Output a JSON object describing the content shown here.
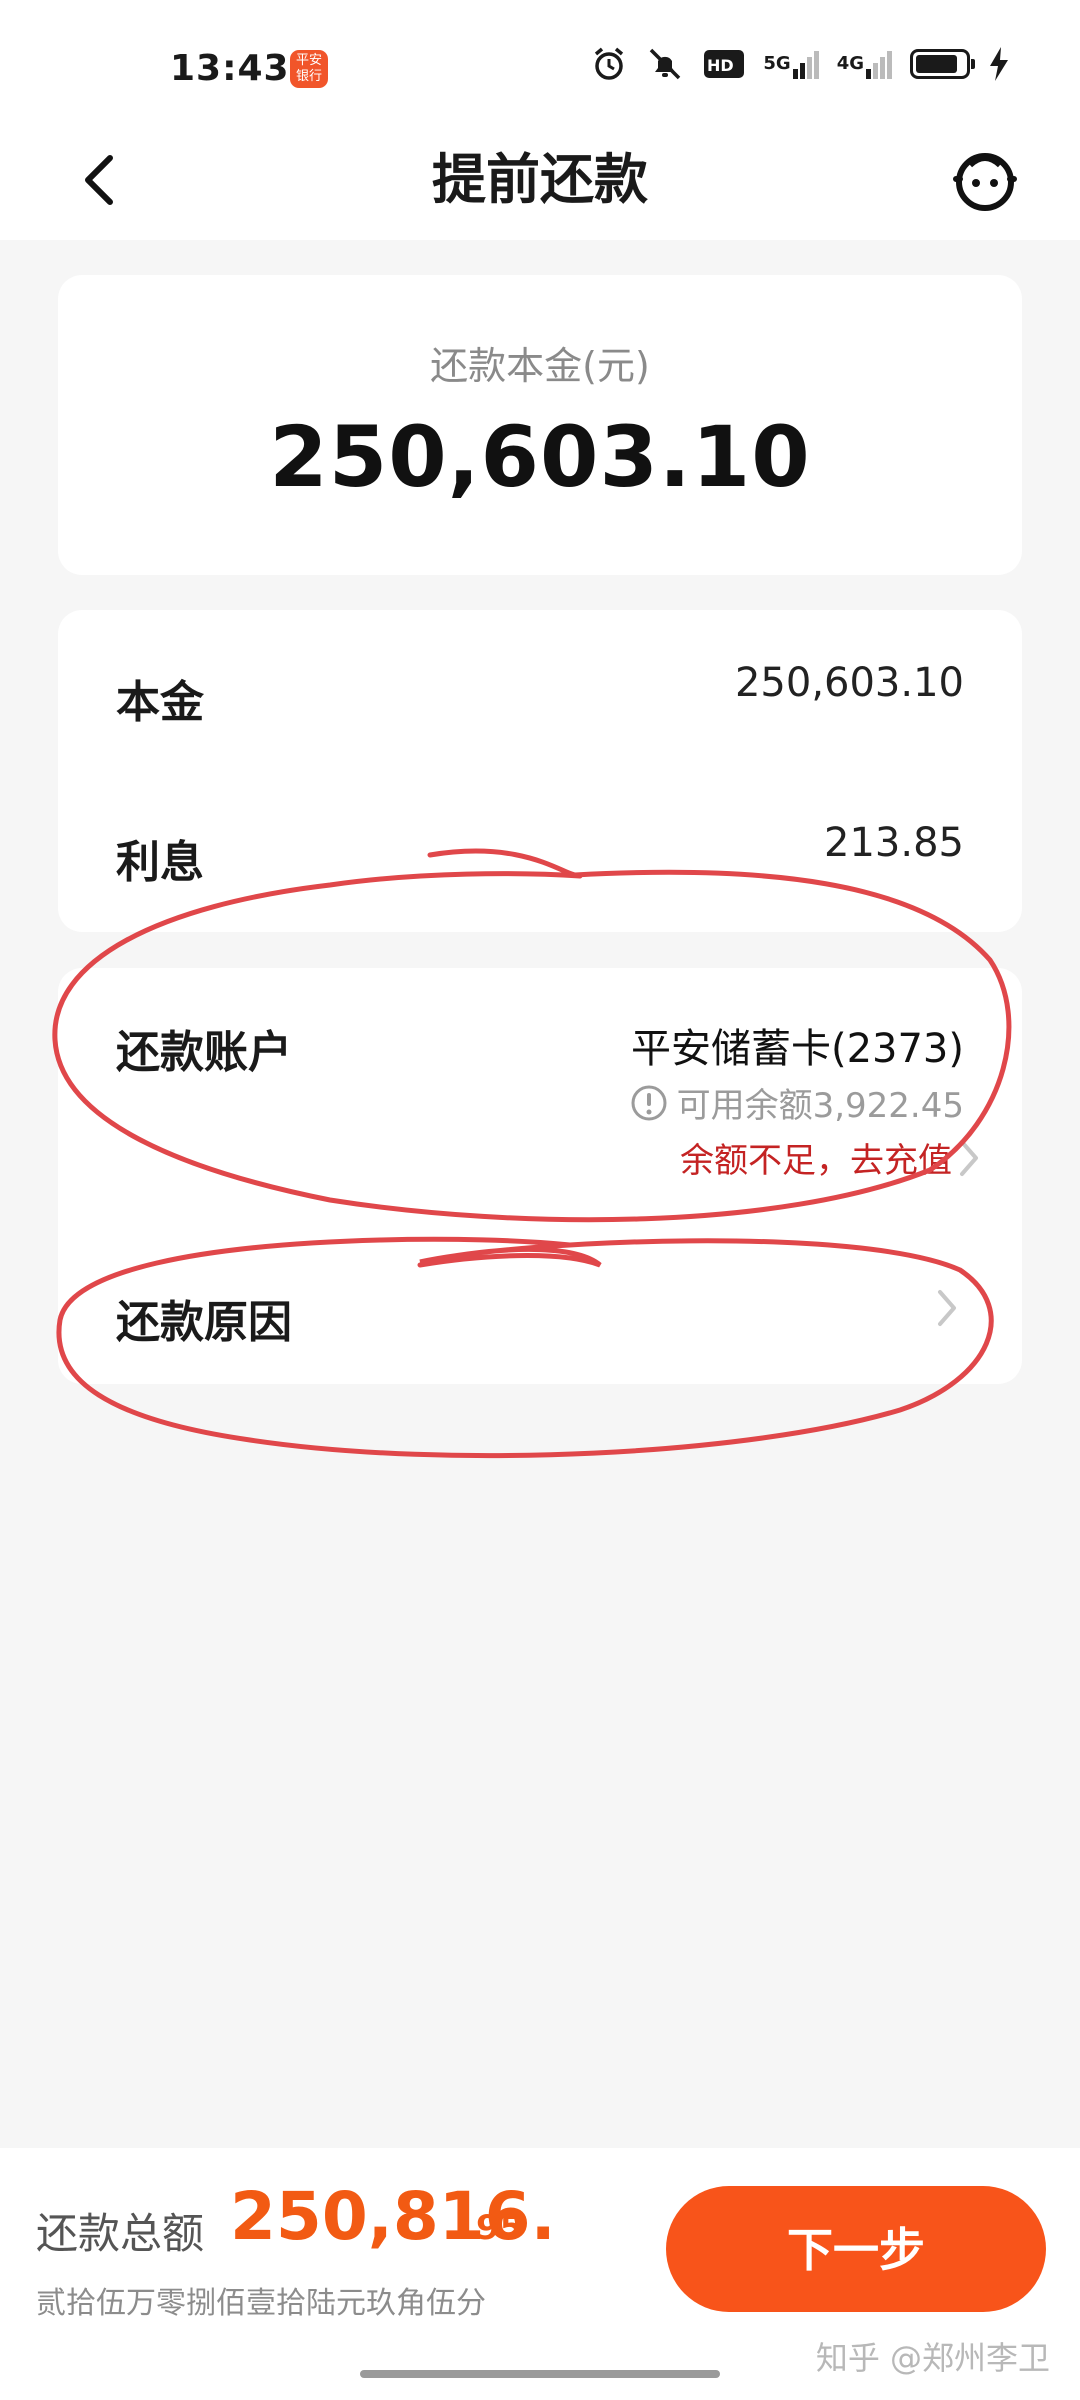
{
  "status_bar": {
    "time": "13:43",
    "app_icon_text": "平安\n银行",
    "hd_label": "HD",
    "net_5g": "5G",
    "net_4g": "4G",
    "battery_level": 0.85
  },
  "header": {
    "title": "提前还款"
  },
  "summary": {
    "label": "还款本金(元)",
    "amount": "250,603.10"
  },
  "detail": {
    "principal_label": "本金",
    "principal_value": "250,603.10",
    "interest_label": "利息",
    "interest_value": "213.85"
  },
  "account": {
    "label": "还款账户",
    "name": "平安储蓄卡(2373)",
    "balance": "可用余额3,922.45",
    "recharge": "余额不足，去充值"
  },
  "reason": {
    "label": "还款原因"
  },
  "footer": {
    "total_label": "还款总额",
    "total_int": "250,816.",
    "total_dec": "95",
    "total_words": "贰拾伍万零捌佰壹拾陆元玖角伍分",
    "next_label": "下一步",
    "watermark": "知乎 @郑州李卫"
  },
  "colors": {
    "accent": "#f8541a",
    "warning": "#c42323",
    "annotation": "#e0474a"
  }
}
